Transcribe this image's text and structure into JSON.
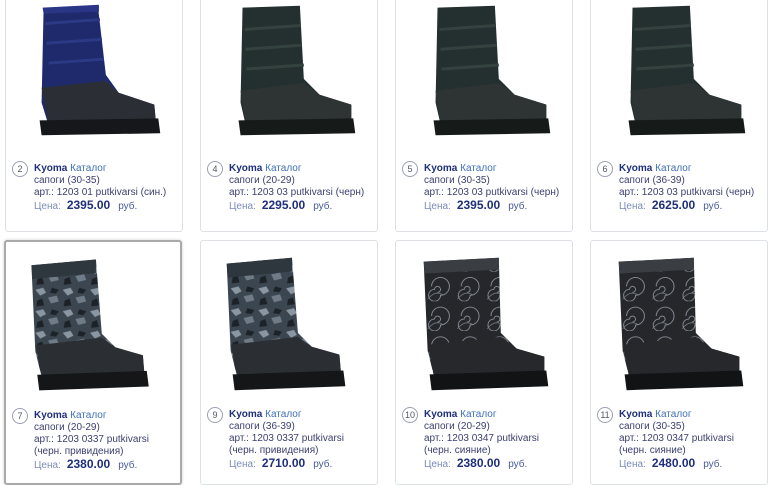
{
  "products": [
    {
      "num": "2",
      "brand": "Kyoma",
      "catalog": "Каталог",
      "type": "сапоги (30-35)",
      "article": "арт.: 1203 01 putkivarsi (син.)",
      "price_label": "Цена:",
      "price": "2395.00",
      "currency": "руб."
    },
    {
      "num": "4",
      "brand": "Kyoma",
      "catalog": "Каталог",
      "type": "сапоги (20-29)",
      "article": "арт.: 1203 03 putkivarsi (черн)",
      "price_label": "Цена:",
      "price": "2295.00",
      "currency": "руб."
    },
    {
      "num": "5",
      "brand": "Kyoma",
      "catalog": "Каталог",
      "type": "сапоги (30-35)",
      "article": "арт.: 1203 03 putkivarsi (черн)",
      "price_label": "Цена:",
      "price": "2395.00",
      "currency": "руб."
    },
    {
      "num": "6",
      "brand": "Kyoma",
      "catalog": "Каталог",
      "type": "сапоги (36-39)",
      "article": "арт.: 1203 03 putkivarsi (черн)",
      "price_label": "Цена:",
      "price": "2625.00",
      "currency": "руб."
    },
    {
      "num": "7",
      "brand": "Kyoma",
      "catalog": "Каталог",
      "type": "сапоги (20-29)",
      "article": "арт.: 1203 0337 putkivarsi",
      "article2": "(черн. привидения)",
      "price_label": "Цена:",
      "price": "2380.00",
      "currency": "руб."
    },
    {
      "num": "9",
      "brand": "Kyoma",
      "catalog": "Каталог",
      "type": "сапоги (36-39)",
      "article": "арт.: 1203 0337 putkivarsi",
      "article2": "(черн. привидения)",
      "price_label": "Цена:",
      "price": "2710.00",
      "currency": "руб."
    },
    {
      "num": "10",
      "brand": "Kyoma",
      "catalog": "Каталог",
      "type": "сапоги (20-29)",
      "article": "арт.: 1203 0347 putkivarsi",
      "article2": "(черн. сияние)",
      "price_label": "Цена:",
      "price": "2380.00",
      "currency": "руб."
    },
    {
      "num": "11",
      "brand": "Kyoma",
      "catalog": "Каталог",
      "type": "сапоги (30-35)",
      "article": "арт.: 1203 0347 putkivarsi",
      "article2": "(черн. сияние)",
      "price_label": "Цена:",
      "price": "2480.00",
      "currency": "руб."
    }
  ]
}
